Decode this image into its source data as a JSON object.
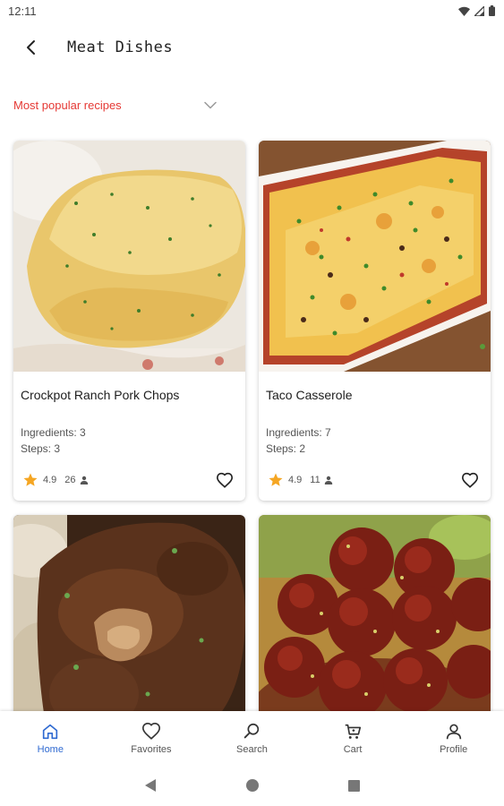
{
  "status_bar": {
    "time": "12:11"
  },
  "app_bar": {
    "title": "Meat Dishes"
  },
  "filter": {
    "selected": "Most popular recipes"
  },
  "recipes": [
    {
      "title": "Crockpot Ranch Pork Chops",
      "ingredients": "Ingredients: 3",
      "steps": "Steps: 3",
      "rating": "4.9",
      "reviews": "26",
      "image": "pork-chops-photo"
    },
    {
      "title": "Taco Casserole",
      "ingredients": "Ingredients: 7",
      "steps": "Steps: 2",
      "rating": "4.9",
      "reviews": "11",
      "image": "taco-casserole-photo"
    },
    {
      "image": "beef-tips-mushroom-gravy-photo"
    },
    {
      "image": "glazed-meatballs-photo"
    }
  ],
  "bottom_nav": [
    {
      "label": "Home",
      "icon": "home-icon",
      "active": true
    },
    {
      "label": "Favorites",
      "icon": "heart-icon"
    },
    {
      "label": "Search",
      "icon": "search-icon"
    },
    {
      "label": "Cart",
      "icon": "cart-icon"
    },
    {
      "label": "Profile",
      "icon": "profile-icon"
    }
  ],
  "colors": {
    "accent": "#e53935",
    "nav_active": "#2f6ad1",
    "star": "#f5a623"
  }
}
